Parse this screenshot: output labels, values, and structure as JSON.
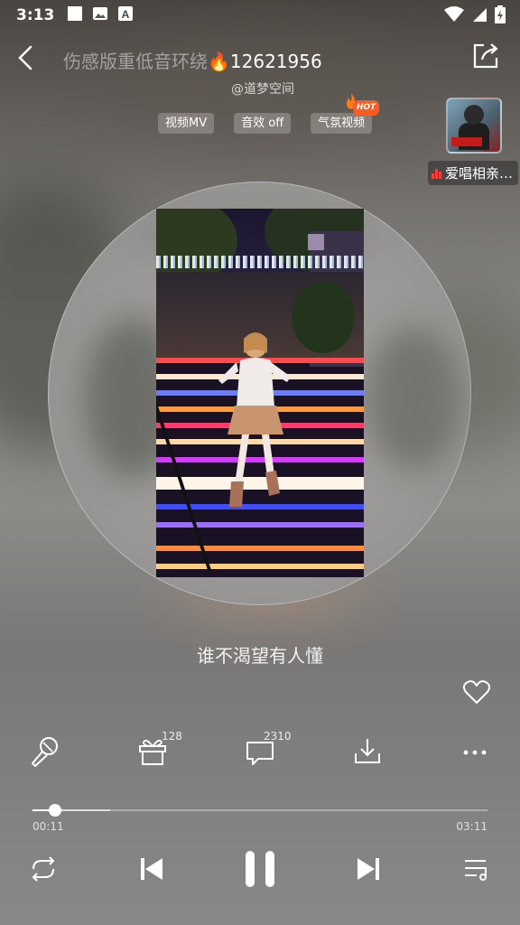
{
  "status_bar": {
    "time": "3:13",
    "icons": [
      "square-notification-icon",
      "image-notification-icon",
      "a-notification-icon",
      "wifi-icon",
      "signal-icon",
      "battery-charging-icon"
    ]
  },
  "header": {
    "title_faded": "伤感版重低音环绕",
    "title_emoji": "🔥",
    "title_number": "12621956",
    "subtitle": "@道梦空间",
    "back_icon": "chevron-left-icon",
    "share_icon": "share-icon"
  },
  "tags": [
    {
      "label": "视频MV"
    },
    {
      "label": "音效 off"
    },
    {
      "label": "气氛视频",
      "badge": "HOT"
    }
  ],
  "side_card": {
    "label": "爱唱相亲…",
    "accent": "#ff3b3b"
  },
  "lyric": "谁不渴望有人懂",
  "actions": {
    "karaoke_icon": "microphone-icon",
    "gift_count": "128",
    "comment_count": "2310",
    "download_icon": "download-icon",
    "more_icon": "more-icon"
  },
  "progress": {
    "current": "00:11",
    "total": "03:11",
    "played_fraction": 0.05,
    "buffered_fraction": 0.17
  },
  "controls": {
    "repeat_icon": "repeat-icon",
    "prev_icon": "skip-previous-icon",
    "play_state": "playing",
    "next_icon": "skip-next-icon",
    "playlist_icon": "playlist-icon"
  },
  "colors": {
    "hot_badge": "#ff5a1f",
    "live_bars": "#ff3b3b"
  }
}
